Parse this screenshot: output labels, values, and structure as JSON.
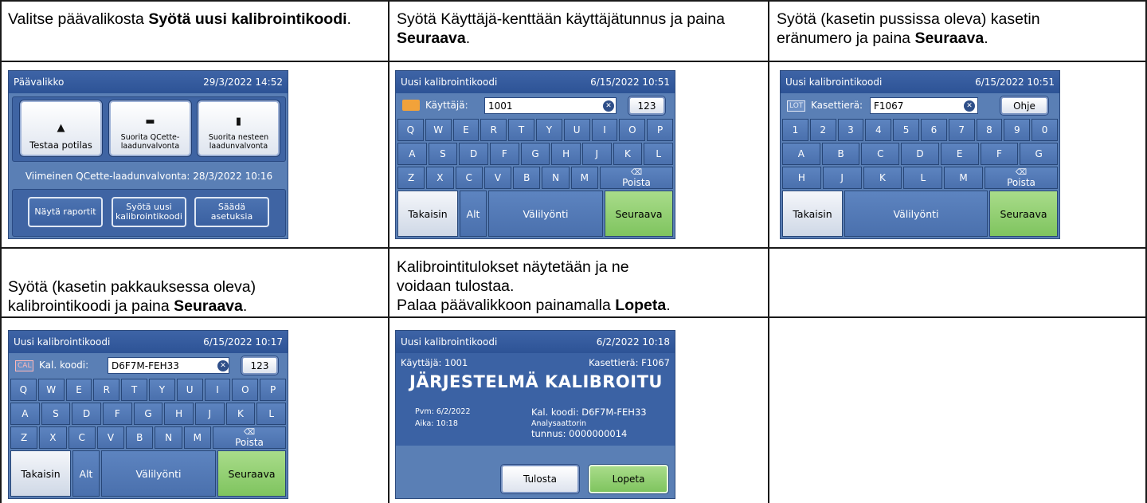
{
  "steps": [
    {
      "pre": "Valitse päävalikosta ",
      "bold": "Syötä uusi kalibrointikoodi",
      "post": "."
    },
    {
      "pre": "Syötä Käyttäjä-kenttään käyttäjätunnus ja paina ",
      "bold": "Seuraava",
      "post": "."
    },
    {
      "pre": "Syötä (kasetin pussissa oleva) kasetin eränumero ja paina ",
      "bold": "Seuraava",
      "post": "."
    },
    {
      "pre": "Syötä (kasetin pakkauksessa oleva) kalibrointikoodi ja paina ",
      "bold": "Seuraava",
      "post": "."
    },
    {
      "line1": "Kalibrointitulokset näytetään ja ne",
      "line2": "voidaan tulostaa.",
      "line3_pre": "Palaa päävalikkoon painamalla ",
      "line3_bold": "Lopeta",
      "line3_post": "."
    }
  ],
  "screen_main": {
    "title": "Päävalikko",
    "datetime": "29/3/2022 14:52",
    "btn_test": "Testaa potilas",
    "btn_qcette": "Suorita QCette-laadunvalvonta",
    "btn_liquid": "Suorita nesteen laadunvalvonta",
    "last_qc": "Viimeinen QCette-laadunvalvonta: 28/3/2022 10:16",
    "btn_reports": "Näytä raportit",
    "btn_newcal": "Syötä uusi kalibrointikoodi",
    "btn_settings": "Säädä asetuksia"
  },
  "screen_user": {
    "title": "Uusi kalibrointikoodi",
    "datetime": "6/15/2022 10:51",
    "field_label": "Käyttäjä:",
    "field_value": "1001",
    "mode_btn": "123"
  },
  "screen_lot": {
    "title": "Uusi kalibrointikoodi",
    "datetime": "6/15/2022 10:51",
    "tag": "LOT",
    "field_label": "Kasettierä:",
    "field_value": "F1067",
    "help_btn": "Ohje"
  },
  "screen_cal": {
    "title": "Uusi kalibrointikoodi",
    "datetime": "6/15/2022 10:17",
    "tag": "CAL",
    "field_label": "Kal. koodi:",
    "field_value": "D6F7M-FEH33",
    "mode_btn": "123"
  },
  "screen_result": {
    "title": "Uusi kalibrointikoodi",
    "datetime": "6/2/2022 10:18",
    "user": "Käyttäjä: 1001",
    "lot": "Kasettierä: F1067",
    "headline": "JÄRJESTELMÄ KALIBROITU",
    "date": "Pvm: 6/2/2022",
    "time": "Aika: 10:18",
    "cal_code": "Kal. koodi: D6F7M-FEH33",
    "analyzer_label": "Analysaattorin",
    "analyzer_id": "tunnus: 0000000014",
    "print_btn": "Tulosta",
    "finish_btn": "Lopeta"
  },
  "keyboard": {
    "row1": [
      "Q",
      "W",
      "E",
      "R",
      "T",
      "Y",
      "U",
      "I",
      "O",
      "P"
    ],
    "row2": [
      "A",
      "S",
      "D",
      "F",
      "G",
      "H",
      "J",
      "K",
      "L"
    ],
    "row3": [
      "Z",
      "X",
      "C",
      "V",
      "B",
      "N",
      "M"
    ],
    "delete": "Poista",
    "back": "Takaisin",
    "alt": "Alt",
    "space": "Välilyönti",
    "next": "Seuraava"
  },
  "keyboard_numeric": {
    "row1": [
      "1",
      "2",
      "3",
      "4",
      "5",
      "6",
      "7",
      "8",
      "9",
      "0"
    ],
    "row2": [
      "A",
      "B",
      "C",
      "D",
      "E",
      "F",
      "G"
    ],
    "row3": [
      "H",
      "J",
      "K",
      "L",
      "M"
    ],
    "delete": "Poista",
    "back": "Takaisin",
    "space": "Välilyönti",
    "next": "Seuraava"
  }
}
